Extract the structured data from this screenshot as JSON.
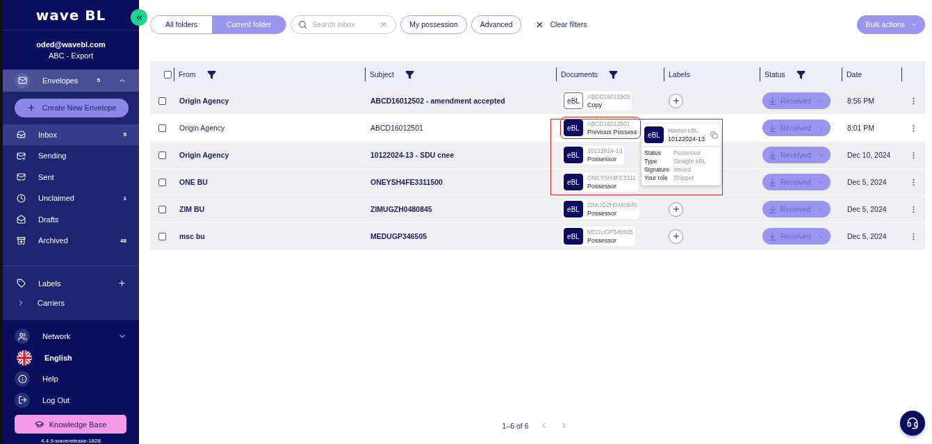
{
  "sidebar": {
    "logo": "wave BL",
    "user": {
      "email": "oded@wavebl.com",
      "org": "ABC - Export"
    },
    "envelopes": {
      "label": "Envelopes",
      "count": "5",
      "expanded": true
    },
    "create_button": "Create New Envelope",
    "folders": [
      {
        "kind": "inbox",
        "label": "Inbox",
        "count": "5",
        "selected": true
      },
      {
        "kind": "sending",
        "label": "Sending",
        "selected": false
      },
      {
        "kind": "sent",
        "label": "Sent",
        "selected": false
      },
      {
        "kind": "unclaimed",
        "label": "Unclaimed",
        "count": "1",
        "selected": false
      },
      {
        "kind": "drafts",
        "label": "Drafts",
        "selected": false
      },
      {
        "kind": "archived",
        "label": "Archived",
        "count": "48",
        "selected": false
      }
    ],
    "labels": {
      "label": "Labels",
      "children": [
        {
          "label": "Carriers",
          "expanded": false
        }
      ]
    },
    "bottom": [
      {
        "kind": "network",
        "label": "Network",
        "expanded": false
      },
      {
        "kind": "language",
        "label": "English"
      },
      {
        "kind": "help",
        "label": "Help"
      },
      {
        "kind": "logout",
        "label": "Log Out"
      }
    ],
    "knowledge_base": "Knowledge Base",
    "version": "4.4.9-waverelease-1828"
  },
  "toolbar": {
    "folder_scope": [
      {
        "label": "All folders",
        "selected": false
      },
      {
        "label": "Current folder",
        "selected": true
      }
    ],
    "search": {
      "placeholder": "Search inbox"
    },
    "filters": [
      "My possession",
      "Advanced"
    ],
    "clear": "Clear filters",
    "bulk": "Bulk actions"
  },
  "table": {
    "select_all_checked": false,
    "columns": [
      {
        "label": "From",
        "filter": true
      },
      {
        "label": "Subject",
        "filter": true
      },
      {
        "label": "Documents",
        "filter": true
      },
      {
        "label": "Labels",
        "filter": false
      },
      {
        "label": "Status",
        "filter": true
      },
      {
        "label": "Date",
        "filter": false
      }
    ],
    "rows": [
      {
        "from": "Origin Agency",
        "subject": "ABCD16012502 - amendment accepted",
        "unread": true,
        "checked": false,
        "doc": {
          "badge": "eBL",
          "number": "ABCD16012502",
          "role": "Copy",
          "master": false,
          "highlighted": false
        },
        "add_label": true,
        "status": "Received",
        "date": "8:56 PM"
      },
      {
        "from": "Origin Agency",
        "subject": "ABCD16012501",
        "unread": false,
        "checked": false,
        "doc": {
          "badge": "eBL",
          "number": "ABCD16012501",
          "role": "Previous Possess",
          "master": true,
          "highlighted": true
        },
        "add_label": false,
        "status": "Received",
        "date": "8:01 PM"
      },
      {
        "from": "Origin Agency",
        "subject": "10122024-13 - SDU cnee",
        "unread": true,
        "checked": false,
        "doc": {
          "badge": "eBL",
          "number": "10122024-13",
          "role": "Possessor",
          "master": true,
          "highlighted": false
        },
        "add_label": false,
        "status": "Received",
        "date": "Dec 10, 2024"
      },
      {
        "from": "ONE BU",
        "subject": "ONEYSH4FE3311500",
        "unread": true,
        "checked": false,
        "doc": {
          "badge": "eBL",
          "number": "ONEYSH4FE3311",
          "role": "Possessor",
          "master": true,
          "highlighted": false
        },
        "add_label": false,
        "status": "Received",
        "date": "Dec 5, 2024"
      },
      {
        "from": "ZIM BU",
        "subject": "ZIMUGZH0480845",
        "unread": true,
        "checked": false,
        "doc": {
          "badge": "eBL",
          "number": "ZIMUGZH0480845",
          "role": "Possessor",
          "master": true,
          "highlighted": false
        },
        "add_label": true,
        "status": "Received",
        "date": "Dec 5, 2024"
      },
      {
        "from": "msc bu",
        "subject": "MEDUGP346505",
        "unread": true,
        "checked": false,
        "doc": {
          "badge": "eBL",
          "number": "MEDUGP346505",
          "role": "Possessor",
          "master": true,
          "highlighted": false
        },
        "add_label": true,
        "status": "Received",
        "date": "Dec 5, 2024"
      }
    ]
  },
  "tooltip": {
    "highlighted": true,
    "badge": "eBL",
    "title": "Master eBL",
    "number": "10122024-13",
    "fields": [
      {
        "label": "Status",
        "value": "Possessor"
      },
      {
        "label": "Type",
        "value": "Straight eBL"
      },
      {
        "label": "Signature",
        "value": "Issued"
      },
      {
        "label": "Your role",
        "value": "Shipper"
      }
    ]
  },
  "pagination": {
    "range": "1–6 of 6"
  }
}
